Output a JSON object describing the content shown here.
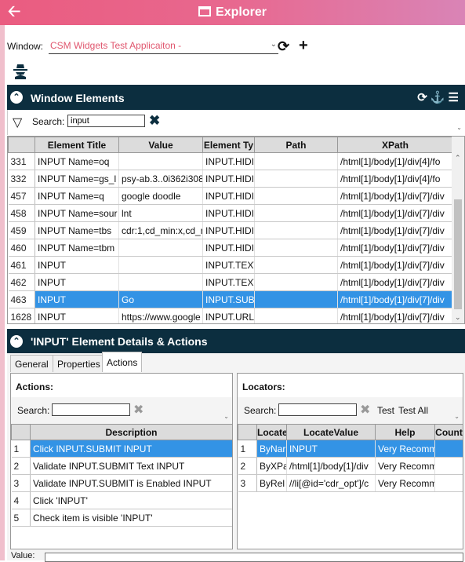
{
  "app": {
    "title": "Explorer",
    "back_icon": "back-arrow-icon"
  },
  "window": {
    "label": "Window:",
    "selected": "CSM Widgets Test Applicaiton -"
  },
  "elements_panel": {
    "title": "Window Elements",
    "search_label": "Search:",
    "search_value": "input",
    "columns": [
      "Element Title",
      "Value",
      "Element Ty",
      "Path",
      "XPath"
    ],
    "rows": [
      {
        "n": "331",
        "title": "INPUT Name=oq",
        "value": "",
        "type": "INPUT.HIDI",
        "path": "",
        "xpath": "/html[1]/body[1]/div[4]/fo"
      },
      {
        "n": "332",
        "title": "INPUT Name=gs_l",
        "value": "psy-ab.3..0i362i308",
        "type": "INPUT.HIDI",
        "path": "",
        "xpath": "/html[1]/body[1]/div[4]/fo"
      },
      {
        "n": "457",
        "title": "INPUT Name=q",
        "value": "google doodle",
        "type": "INPUT.HIDI",
        "path": "",
        "xpath": "/html[1]/body[1]/div[7]/div"
      },
      {
        "n": "458",
        "title": "INPUT Name=sour",
        "value": "lnt",
        "type": "INPUT.HIDI",
        "path": "",
        "xpath": "/html[1]/body[1]/div[7]/div"
      },
      {
        "n": "459",
        "title": "INPUT Name=tbs",
        "value": "cdr:1,cd_min:x,cd_m",
        "type": "INPUT.HIDI",
        "path": "",
        "xpath": "/html[1]/body[1]/div[7]/div"
      },
      {
        "n": "460",
        "title": "INPUT Name=tbm",
        "value": "",
        "type": "INPUT.HIDI",
        "path": "",
        "xpath": "/html[1]/body[1]/div[7]/div"
      },
      {
        "n": "461",
        "title": "INPUT",
        "value": "",
        "type": "INPUT.TEXT",
        "path": "",
        "xpath": "/html[1]/body[1]/div[7]/div"
      },
      {
        "n": "462",
        "title": "INPUT",
        "value": "",
        "type": "INPUT.TEXT",
        "path": "",
        "xpath": "/html[1]/body[1]/div[7]/div"
      },
      {
        "n": "463",
        "title": "INPUT",
        "value": "Go",
        "type": "INPUT.SUB",
        "path": "",
        "xpath": "/html[1]/body[1]/div[7]/div"
      },
      {
        "n": "1628",
        "title": "INPUT",
        "value": "https://www.google",
        "type": "INPUT.URL",
        "path": "",
        "xpath": "/html[1]/body[1]/div[7]/div"
      }
    ],
    "selected_row": 8
  },
  "details_panel": {
    "title": "'INPUT' Element Details & Actions",
    "tabs": [
      "General",
      "Properties",
      "Actions"
    ],
    "active_tab": 2
  },
  "actions": {
    "header": "Actions:",
    "search_label": "Search:",
    "column": "Description",
    "rows": [
      {
        "n": "1",
        "desc": "Click INPUT.SUBMIT INPUT"
      },
      {
        "n": "2",
        "desc": "Validate INPUT.SUBMIT Text INPUT"
      },
      {
        "n": "3",
        "desc": "Validate INPUT.SUBMIT is Enabled INPUT"
      },
      {
        "n": "4",
        "desc": "Click 'INPUT'"
      },
      {
        "n": "5",
        "desc": "Check item is visible 'INPUT'"
      }
    ]
  },
  "locators": {
    "header": "Locators:",
    "search_label": "Search:",
    "test_label": "Test",
    "test_all_label": "Test All",
    "columns": [
      "Locate",
      "LocateValue",
      "Help",
      "Count"
    ],
    "rows": [
      {
        "n": "1",
        "by": "ByNar",
        "value": "INPUT",
        "help": "Very Recomm",
        "count": ""
      },
      {
        "n": "2",
        "by": "ByXPa",
        "value": "/html[1]/body[1]/div",
        "help": "Very Recomm",
        "count": ""
      },
      {
        "n": "3",
        "by": "ByRel",
        "value": "//li[@id='cdr_opt']/c",
        "help": "Very Recomm",
        "count": ""
      }
    ]
  },
  "value_label": "Value:",
  "colors": {
    "accent": "#e8688f",
    "dark_header": "#0c2e3f",
    "selection": "#3393e5"
  }
}
